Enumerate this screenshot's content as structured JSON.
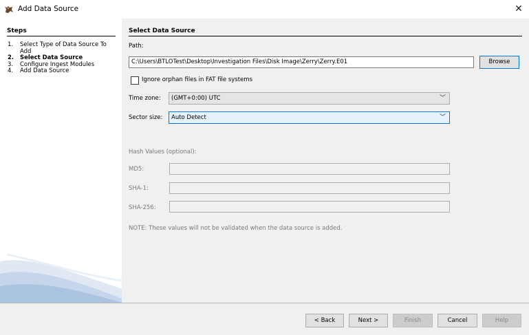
{
  "window": {
    "title": "Add Data Source",
    "close_glyph": "✕"
  },
  "steps": {
    "title": "Steps",
    "items": [
      {
        "num": "1.",
        "label": "Select Type of Data Source To Add"
      },
      {
        "num": "2.",
        "label": "Select Data Source"
      },
      {
        "num": "3.",
        "label": "Configure Ingest Modules"
      },
      {
        "num": "4.",
        "label": "Add Data Source"
      }
    ],
    "active_index": 1
  },
  "panel": {
    "title": "Select Data Source",
    "path_label": "Path:",
    "path_value": "C:\\Users\\BTLOTest\\Desktop\\Investigation Files\\Disk Image\\Zerry\\Zerry.E01",
    "browse_label": "Browse",
    "orphan_checkbox_label": "Ignore orphan files in FAT file systems",
    "orphan_checked": false,
    "timezone_label": "Time zone:",
    "timezone_value": "(GMT+0:00) UTC",
    "sector_label": "Sector size:",
    "sector_value": "Auto Detect",
    "hash_title": "Hash Values (optional):",
    "md5_label": "MD5:",
    "sha1_label": "SHA-1:",
    "sha256_label": "SHA-256:",
    "note": "NOTE: These values will not be validated when the data source is added."
  },
  "buttons": {
    "back": "< Back",
    "next": "Next >",
    "finish": "Finish",
    "cancel": "Cancel",
    "help": "Help"
  },
  "icons": {
    "app": "autopsy-dog-icon",
    "close": "close-icon",
    "dropdown": "chevron-down-icon"
  },
  "colors": {
    "accent": "#0078d7",
    "panel_white": "#ffffff",
    "dialog_gray": "#f0f0f0"
  }
}
